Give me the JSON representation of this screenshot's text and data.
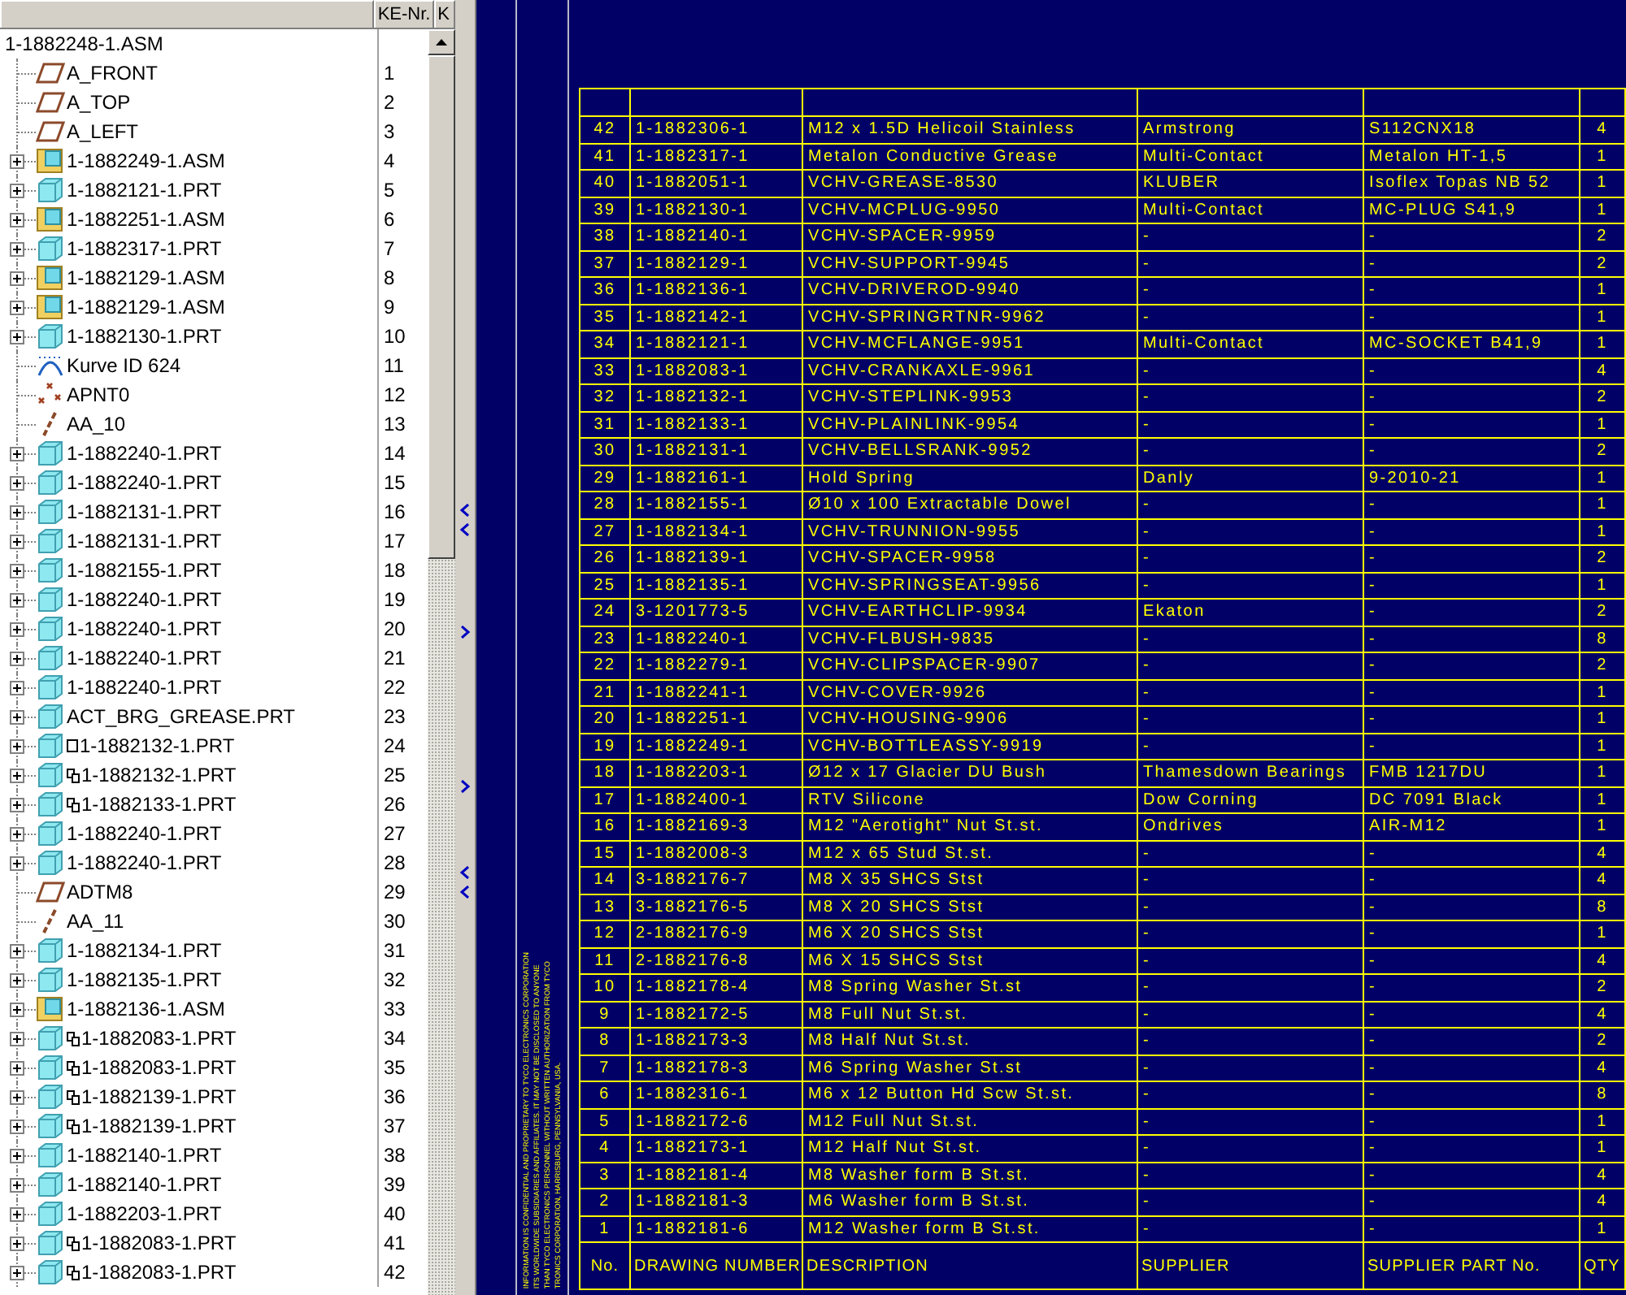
{
  "tree": {
    "columns": [
      "KE-Nr.",
      "K"
    ],
    "root": "1-1882248-1.ASM",
    "items": [
      {
        "name": "A_FRONT",
        "kind": "plane",
        "expandable": false,
        "ke_nr": "1"
      },
      {
        "name": "A_TOP",
        "kind": "plane",
        "expandable": false,
        "ke_nr": "2"
      },
      {
        "name": "A_LEFT",
        "kind": "plane",
        "expandable": false,
        "ke_nr": "3"
      },
      {
        "name": "1-1882249-1.ASM",
        "kind": "asm",
        "expandable": true,
        "expanded": false,
        "ke_nr": "4"
      },
      {
        "name": "1-1882121-1.PRT",
        "kind": "prt",
        "expandable": true,
        "expanded": false,
        "ke_nr": "5"
      },
      {
        "name": "1-1882251-1.ASM",
        "kind": "asm",
        "expandable": true,
        "expanded": false,
        "ke_nr": "6"
      },
      {
        "name": "1-1882317-1.PRT",
        "kind": "prt",
        "expandable": true,
        "expanded": false,
        "ke_nr": "7"
      },
      {
        "name": "1-1882129-1.ASM",
        "kind": "asm",
        "expandable": true,
        "expanded": false,
        "ke_nr": "8"
      },
      {
        "name": "1-1882129-1.ASM",
        "kind": "asm",
        "expandable": true,
        "expanded": false,
        "ke_nr": "9"
      },
      {
        "name": "1-1882130-1.PRT",
        "kind": "prt",
        "expandable": true,
        "expanded": false,
        "ke_nr": "10"
      },
      {
        "name": "Kurve ID 624",
        "kind": "curve",
        "expandable": false,
        "ke_nr": "11"
      },
      {
        "name": "APNT0",
        "kind": "point",
        "expandable": false,
        "ke_nr": "12"
      },
      {
        "name": "AA_10",
        "kind": "axis",
        "expandable": false,
        "ke_nr": "13"
      },
      {
        "name": "1-1882240-1.PRT",
        "kind": "prt",
        "expandable": true,
        "expanded": false,
        "ke_nr": "14"
      },
      {
        "name": "1-1882240-1.PRT",
        "kind": "prt",
        "expandable": true,
        "expanded": false,
        "ke_nr": "15"
      },
      {
        "name": "1-1882131-1.PRT",
        "kind": "prt",
        "expandable": true,
        "expanded": false,
        "ke_nr": "16"
      },
      {
        "name": "1-1882131-1.PRT",
        "kind": "prt",
        "expandable": true,
        "expanded": false,
        "ke_nr": "17"
      },
      {
        "name": "1-1882155-1.PRT",
        "kind": "prt",
        "expandable": true,
        "expanded": false,
        "ke_nr": "18"
      },
      {
        "name": "1-1882240-1.PRT",
        "kind": "prt",
        "expandable": true,
        "expanded": false,
        "ke_nr": "19"
      },
      {
        "name": "1-1882240-1.PRT",
        "kind": "prt",
        "expandable": true,
        "expanded": false,
        "ke_nr": "20"
      },
      {
        "name": "1-1882240-1.PRT",
        "kind": "prt",
        "expandable": true,
        "expanded": false,
        "ke_nr": "21"
      },
      {
        "name": "1-1882240-1.PRT",
        "kind": "prt",
        "expandable": true,
        "expanded": false,
        "ke_nr": "22"
      },
      {
        "name": "ACT_BRG_GREASE.PRT",
        "kind": "prt",
        "expandable": true,
        "expanded": false,
        "ke_nr": "23"
      },
      {
        "name": "1-1882132-1.PRT",
        "kind": "prt",
        "expandable": true,
        "expanded": false,
        "marker": {
          "kind": "box"
        },
        "ke_nr": "24"
      },
      {
        "name": "1-1882132-1.PRT",
        "kind": "prt",
        "expandable": true,
        "expanded": false,
        "marker": {
          "kind": "copy"
        },
        "ke_nr": "25"
      },
      {
        "name": "1-1882133-1.PRT",
        "kind": "prt",
        "expandable": true,
        "expanded": false,
        "marker": {
          "kind": "copy"
        },
        "ke_nr": "26"
      },
      {
        "name": "1-1882240-1.PRT",
        "kind": "prt",
        "expandable": true,
        "expanded": false,
        "ke_nr": "27"
      },
      {
        "name": "1-1882240-1.PRT",
        "kind": "prt",
        "expandable": true,
        "expanded": false,
        "ke_nr": "28"
      },
      {
        "name": "ADTM8",
        "kind": "plane",
        "expandable": false,
        "ke_nr": "29"
      },
      {
        "name": "AA_11",
        "kind": "axis",
        "expandable": false,
        "ke_nr": "30"
      },
      {
        "name": "1-1882134-1.PRT",
        "kind": "prt",
        "expandable": true,
        "expanded": false,
        "ke_nr": "31"
      },
      {
        "name": "1-1882135-1.PRT",
        "kind": "prt",
        "expandable": true,
        "expanded": false,
        "ke_nr": "32"
      },
      {
        "name": "1-1882136-1.ASM",
        "kind": "asm",
        "expandable": true,
        "expanded": false,
        "ke_nr": "33"
      },
      {
        "name": "1-1882083-1.PRT",
        "kind": "prt",
        "expandable": true,
        "expanded": false,
        "marker": {
          "kind": "copy"
        },
        "ke_nr": "34"
      },
      {
        "name": "1-1882083-1.PRT",
        "kind": "prt",
        "expandable": true,
        "expanded": false,
        "marker": {
          "kind": "copy"
        },
        "ke_nr": "35"
      },
      {
        "name": "1-1882139-1.PRT",
        "kind": "prt",
        "expandable": true,
        "expanded": false,
        "marker": {
          "kind": "copy"
        },
        "ke_nr": "36"
      },
      {
        "name": "1-1882139-1.PRT",
        "kind": "prt",
        "expandable": true,
        "expanded": false,
        "marker": {
          "kind": "copy"
        },
        "ke_nr": "37"
      },
      {
        "name": "1-1882140-1.PRT",
        "kind": "prt",
        "expandable": true,
        "expanded": false,
        "ke_nr": "38"
      },
      {
        "name": "1-1882140-1.PRT",
        "kind": "prt",
        "expandable": true,
        "expanded": false,
        "ke_nr": "39"
      },
      {
        "name": "1-1882203-1.PRT",
        "kind": "prt",
        "expandable": true,
        "expanded": false,
        "ke_nr": "40"
      },
      {
        "name": "1-1882083-1.PRT",
        "kind": "prt",
        "expandable": true,
        "expanded": false,
        "marker": {
          "kind": "copy"
        },
        "ke_nr": "41"
      },
      {
        "name": "1-1882083-1.PRT",
        "kind": "prt",
        "expandable": true,
        "expanded": false,
        "marker": {
          "kind": "copy"
        },
        "ke_nr": "42"
      }
    ]
  },
  "drawing": {
    "note_lines": [
      "INFORMATION IS CONFIDENTIAL AND PROPRIETARY TO TYCO ELECTRONICS CORPORATION",
      "ITS WORLDWIDE SUBSIDIARIES AND AFFILIATES. IT MAY NOT BE DISCLOSED TO ANYONE",
      "THAN TYCO ELECTRONICS PERSONNEL WITHOUT WRITTEN AUTHORIZATION FROM TYCO",
      "TRONICS CORPORATION, HARRISBURG, PENNSYLVANIA, USA."
    ],
    "bom": {
      "rows": [
        [
          "42",
          "1-1882306-1",
          "M12 x 1.5D Helicoil Stainless",
          "Armstrong",
          "S112CNX18",
          "4"
        ],
        [
          "41",
          "1-1882317-1",
          "Metalon Conductive Grease",
          "Multi-Contact",
          "Metalon HT-1,5",
          "1"
        ],
        [
          "40",
          "1-1882051-1",
          "VCHV-GREASE-8530",
          "KLUBER",
          "Isoflex Topas NB 52",
          "1"
        ],
        [
          "39",
          "1-1882130-1",
          "VCHV-MCPLUG-9950",
          "Multi-Contact",
          "MC-PLUG S41,9",
          "1"
        ],
        [
          "38",
          "1-1882140-1",
          "VCHV-SPACER-9959",
          "-",
          "-",
          "2"
        ],
        [
          "37",
          "1-1882129-1",
          "VCHV-SUPPORT-9945",
          "-",
          "-",
          "2"
        ],
        [
          "36",
          "1-1882136-1",
          "VCHV-DRIVEROD-9940",
          "-",
          "-",
          "1"
        ],
        [
          "35",
          "1-1882142-1",
          "VCHV-SPRINGRTNR-9962",
          "-",
          "-",
          "1"
        ],
        [
          "34",
          "1-1882121-1",
          "VCHV-MCFLANGE-9951",
          "Multi-Contact",
          "MC-SOCKET B41,9",
          "1"
        ],
        [
          "33",
          "1-1882083-1",
          "VCHV-CRANKAXLE-9961",
          "-",
          "-",
          "4"
        ],
        [
          "32",
          "1-1882132-1",
          "VCHV-STEPLINK-9953",
          "-",
          "-",
          "2"
        ],
        [
          "31",
          "1-1882133-1",
          "VCHV-PLAINLINK-9954",
          "-",
          "-",
          "1"
        ],
        [
          "30",
          "1-1882131-1",
          "VCHV-BELLSRANK-9952",
          "-",
          "-",
          "2"
        ],
        [
          "29",
          "1-1882161-1",
          "Hold Spring",
          "Danly",
          "9-2010-21",
          "1"
        ],
        [
          "28",
          "1-1882155-1",
          "Ø10 x 100 Extractable Dowel",
          "-",
          "-",
          "1"
        ],
        [
          "27",
          "1-1882134-1",
          "VCHV-TRUNNION-9955",
          "-",
          "-",
          "1"
        ],
        [
          "26",
          "1-1882139-1",
          "VCHV-SPACER-9958",
          "-",
          "-",
          "2"
        ],
        [
          "25",
          "1-1882135-1",
          "VCHV-SPRINGSEAT-9956",
          "-",
          "-",
          "1"
        ],
        [
          "24",
          "3-1201773-5",
          "VCHV-EARTHCLIP-9934",
          "Ekaton",
          "-",
          "2"
        ],
        [
          "23",
          "1-1882240-1",
          "VCHV-FLBUSH-9835",
          "-",
          "-",
          "8"
        ],
        [
          "22",
          "1-1882279-1",
          "VCHV-CLIPSPACER-9907",
          "-",
          "-",
          "2"
        ],
        [
          "21",
          "1-1882241-1",
          "VCHV-COVER-9926",
          "-",
          "-",
          "1"
        ],
        [
          "20",
          "1-1882251-1",
          "VCHV-HOUSING-9906",
          "-",
          "-",
          "1"
        ],
        [
          "19",
          "1-1882249-1",
          "VCHV-BOTTLEASSY-9919",
          "-",
          "-",
          "1"
        ],
        [
          "18",
          "1-1882203-1",
          "Ø12 x 17 Glacier DU Bush",
          "Thamesdown Bearings",
          "FMB 1217DU",
          "1"
        ],
        [
          "17",
          "1-1882400-1",
          "RTV Silicone",
          "Dow Corning",
          "DC 7091 Black",
          "1"
        ],
        [
          "16",
          "1-1882169-3",
          "M12 \"Aerotight\" Nut St.st.",
          "Ondrives",
          "AIR-M12",
          "1"
        ],
        [
          "15",
          "1-1882008-3",
          "M12 x 65 Stud St.st.",
          "-",
          "-",
          "4"
        ],
        [
          "14",
          "3-1882176-7",
          "M8 X 35 SHCS Stst",
          "-",
          "-",
          "4"
        ],
        [
          "13",
          "3-1882176-5",
          "M8 X 20 SHCS Stst",
          "-",
          "-",
          "8"
        ],
        [
          "12",
          "2-1882176-9",
          "M6 X 20 SHCS Stst",
          "-",
          "-",
          "1"
        ],
        [
          "11",
          "2-1882176-8",
          "M6 X 15 SHCS Stst",
          "-",
          "-",
          "4"
        ],
        [
          "10",
          "1-1882178-4",
          "M8 Spring Washer St.st",
          "-",
          "-",
          "2"
        ],
        [
          "9",
          "1-1882172-5",
          "M8 Full Nut St.st.",
          "-",
          "-",
          "4"
        ],
        [
          "8",
          "1-1882173-3",
          "M8 Half Nut St.st.",
          "-",
          "-",
          "2"
        ],
        [
          "7",
          "1-1882178-3",
          "M6 Spring Washer St.st",
          "-",
          "-",
          "4"
        ],
        [
          "6",
          "1-1882316-1",
          "M6 x 12 Button Hd Scw St.st.",
          "-",
          "-",
          "8"
        ],
        [
          "5",
          "1-1882172-6",
          "M12 Full Nut St.st.",
          "-",
          "-",
          "1"
        ],
        [
          "4",
          "1-1882173-1",
          "M12 Half Nut St.st.",
          "-",
          "-",
          "1"
        ],
        [
          "3",
          "1-1882181-4",
          "M8 Washer form B St.st.",
          "-",
          "-",
          "4"
        ],
        [
          "2",
          "1-1882181-3",
          "M6 Washer form B St.st.",
          "-",
          "-",
          "4"
        ],
        [
          "1",
          "1-1882181-6",
          "M12 Washer form B St.st.",
          "-",
          "-",
          "1"
        ]
      ],
      "title_row": [
        "No.",
        "DRAWING NUMBER",
        "DESCRIPTION",
        "SUPPLIER",
        "SUPPLIER PART No.",
        "QTY"
      ]
    }
  }
}
